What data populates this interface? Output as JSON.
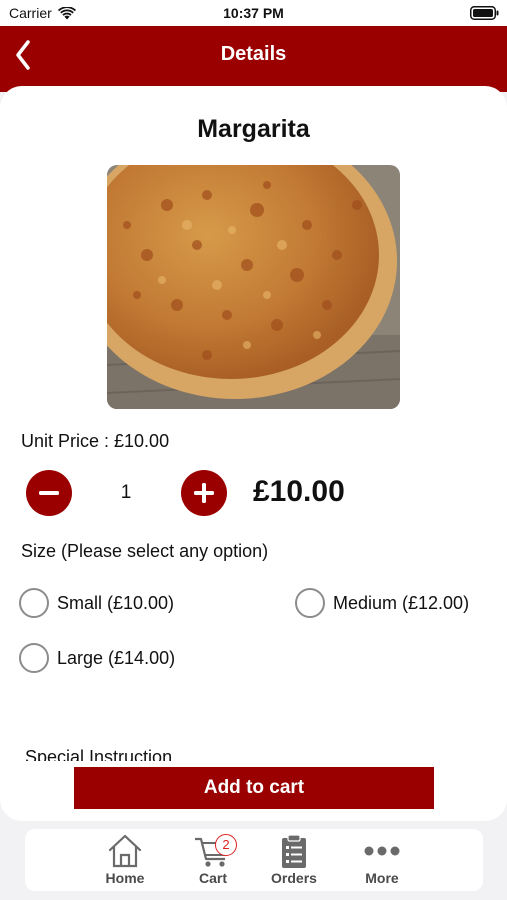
{
  "status_bar": {
    "carrier": "Carrier",
    "time": "10:37 PM"
  },
  "header": {
    "title": "Details"
  },
  "product": {
    "name": "Margarita"
  },
  "pricing": {
    "unit_price_text": "Unit Price : £10.00",
    "quantity": "1",
    "total": "£10.00"
  },
  "size": {
    "label": "Size (Please select any option)",
    "options": [
      {
        "label": "Small (£10.00)",
        "selected": false
      },
      {
        "label": "Medium (£12.00)",
        "selected": false
      },
      {
        "label": "Large (£14.00)",
        "selected": false
      }
    ]
  },
  "special_instruction": {
    "label": "Special Instruction"
  },
  "actions": {
    "add_to_cart": "Add to cart"
  },
  "tab_bar": {
    "items": [
      {
        "label": "Home",
        "icon": "house-icon"
      },
      {
        "label": "Cart",
        "icon": "cart-icon",
        "badge": "2"
      },
      {
        "label": "Orders",
        "icon": "clipboard-icon"
      },
      {
        "label": "More",
        "icon": "ellipsis-icon"
      }
    ]
  },
  "colors": {
    "brand": "#9b0000",
    "badge": "#dd2222"
  }
}
